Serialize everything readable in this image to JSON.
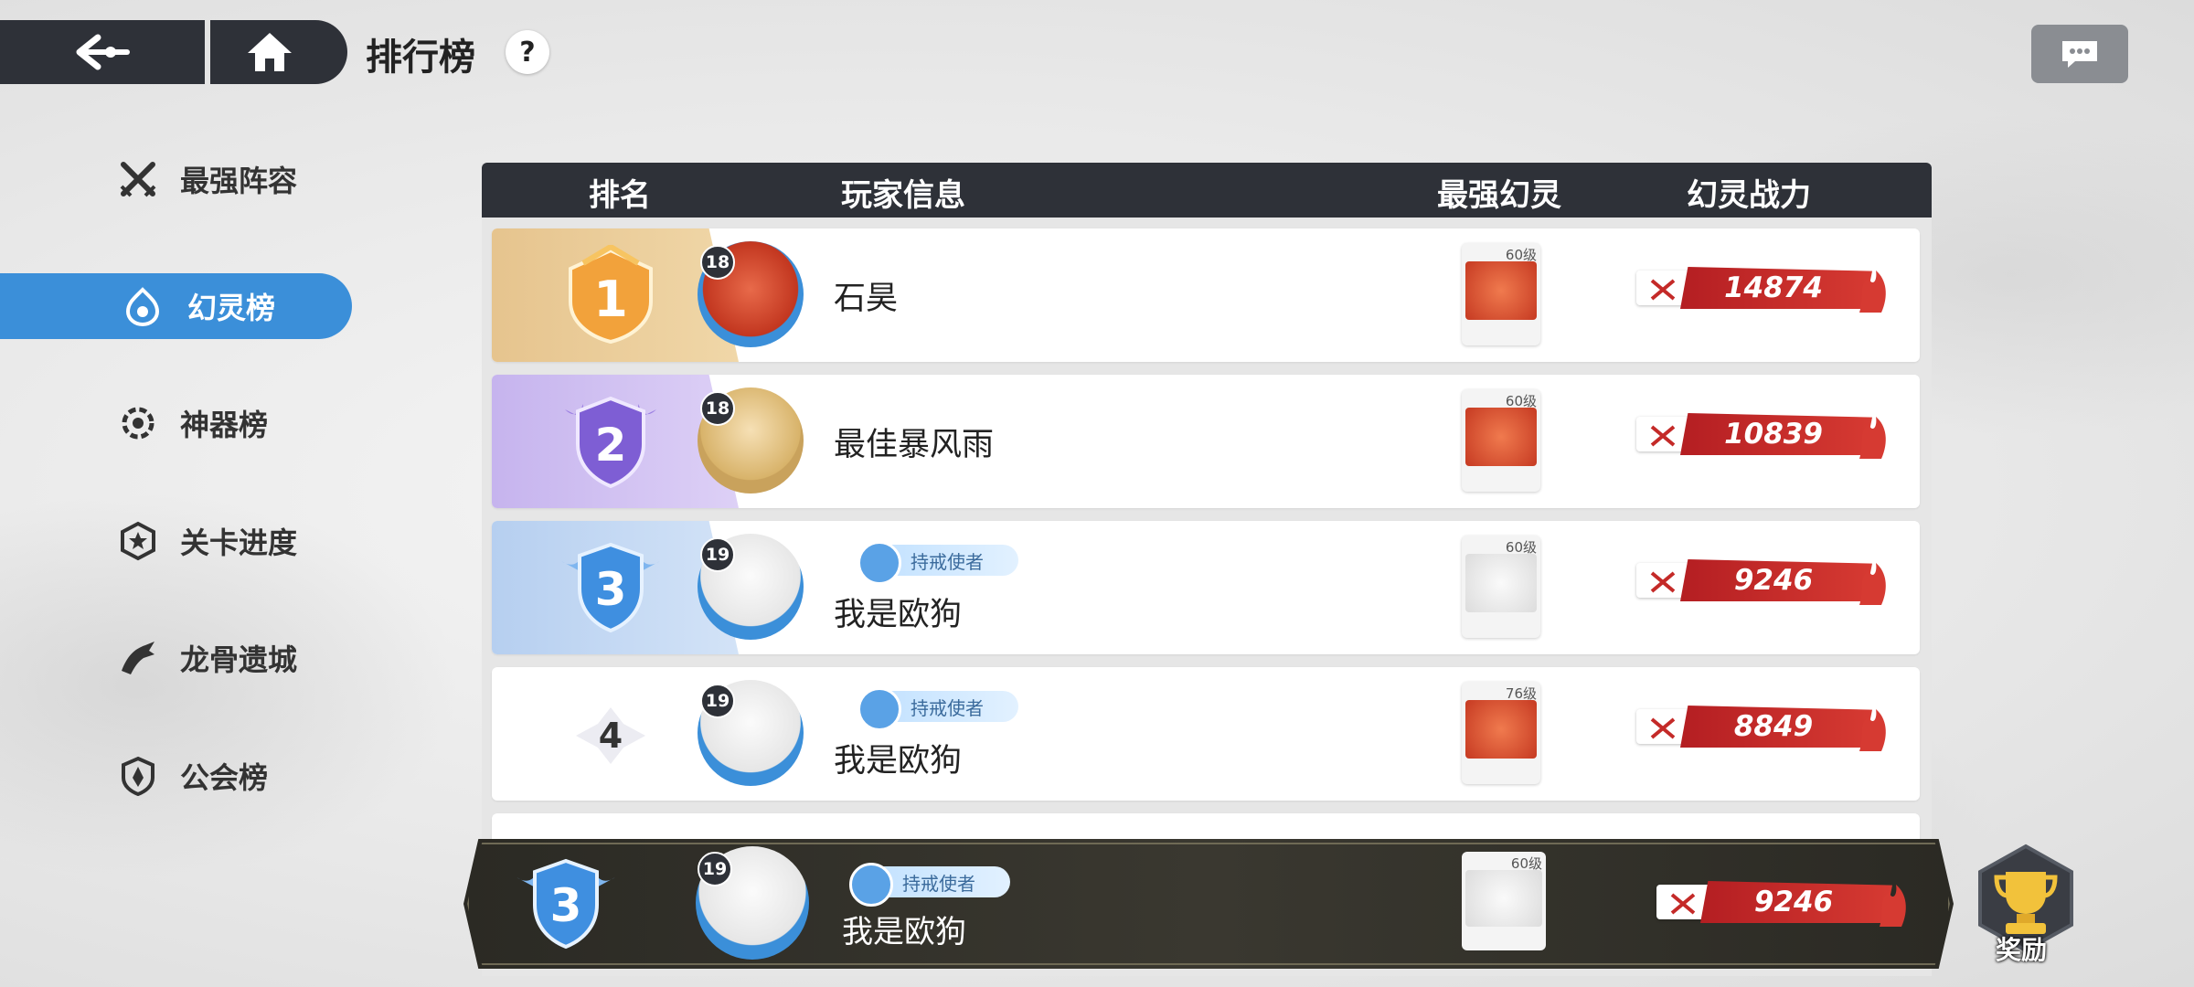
{
  "header": {
    "title": "排行榜",
    "help": "?"
  },
  "sidebar": {
    "items": [
      {
        "label": "最强阵容",
        "icon": "crossed-swords-icon",
        "active": false
      },
      {
        "label": "幻灵榜",
        "icon": "spirit-flame-icon",
        "active": true
      },
      {
        "label": "神器榜",
        "icon": "artifact-gear-icon",
        "active": false
      },
      {
        "label": "关卡进度",
        "icon": "star-badge-icon",
        "active": false
      },
      {
        "label": "龙骨遗城",
        "icon": "dragon-icon",
        "active": false
      },
      {
        "label": "公会榜",
        "icon": "guild-shield-icon",
        "active": false
      }
    ]
  },
  "table": {
    "headers": {
      "rank": "排名",
      "player": "玩家信息",
      "spirit": "最强幻灵",
      "power": "幻灵战力"
    },
    "rows": [
      {
        "rank": "1",
        "level": "18",
        "name": "石昊",
        "title": "",
        "spirit_level": "60级",
        "power": "14874",
        "tier": "gold"
      },
      {
        "rank": "2",
        "level": "18",
        "name": "最佳暴风雨",
        "title": "",
        "spirit_level": "60级",
        "power": "10839",
        "tier": "purple"
      },
      {
        "rank": "3",
        "level": "19",
        "name": "我是欧狗",
        "title": "持戒使者",
        "spirit_level": "60级",
        "power": "9246",
        "tier": "blue"
      },
      {
        "rank": "4",
        "level": "19",
        "name": "我是欧狗",
        "title": "持戒使者",
        "spirit_level": "76级",
        "power": "8849",
        "tier": "plain"
      }
    ]
  },
  "my_rank": {
    "rank": "3",
    "level": "19",
    "name": "我是欧狗",
    "title": "持戒使者",
    "spirit_level": "60级",
    "power": "9246"
  },
  "reward": {
    "label": "奖励"
  },
  "colors": {
    "active_tab": "#3b8fd9",
    "header_bar": "#2e3138",
    "power_red": "#c42a28",
    "gold": "#e8c48a",
    "purple": "#c9b8ef",
    "blue": "#b9d3f2"
  }
}
